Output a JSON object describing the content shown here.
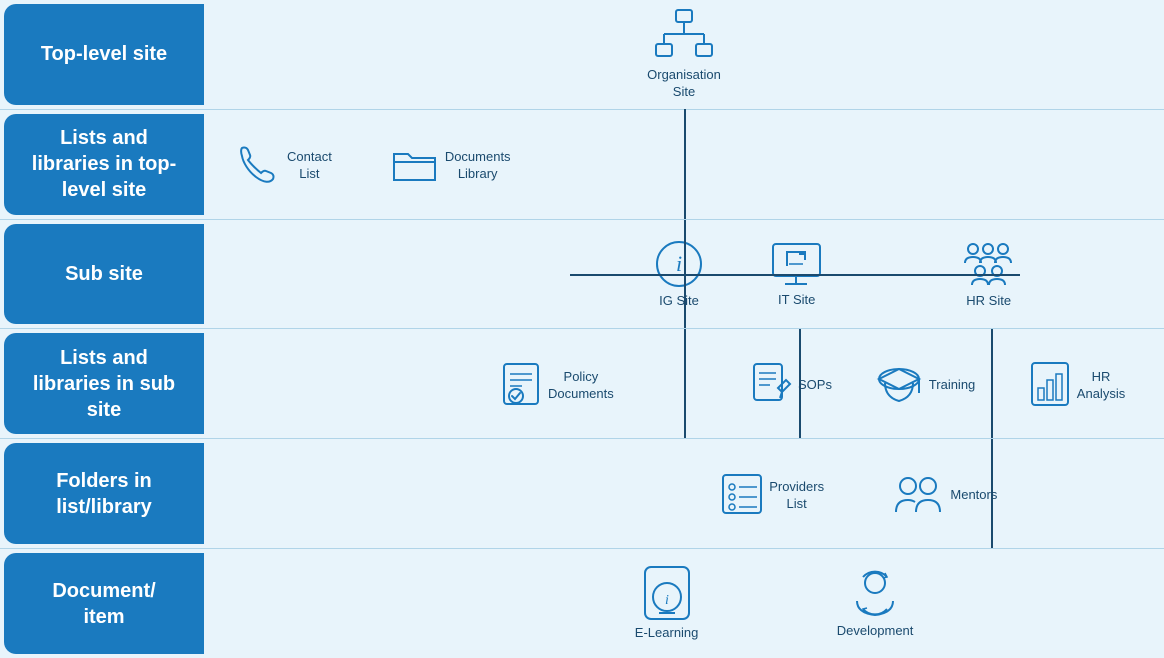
{
  "rows": [
    {
      "id": "top-level-site",
      "label": "Top-level site",
      "nodes": [
        {
          "id": "org-site",
          "label": "Organisation\nSite",
          "icon": "org"
        }
      ]
    },
    {
      "id": "lists-top",
      "label": "Lists and\nlibraries in top-\nlevel site",
      "nodes": [
        {
          "id": "contact-list",
          "label": "Contact\nList",
          "icon": "phone"
        },
        {
          "id": "documents-library",
          "label": "Documents\nLibrary",
          "icon": "folder"
        }
      ]
    },
    {
      "id": "sub-site",
      "label": "Sub site",
      "nodes": [
        {
          "id": "ig-site",
          "label": "IG Site",
          "icon": "info"
        },
        {
          "id": "it-site",
          "label": "IT Site",
          "icon": "monitor"
        },
        {
          "id": "hr-site",
          "label": "HR Site",
          "icon": "people"
        }
      ]
    },
    {
      "id": "lists-sub",
      "label": "Lists and\nlibraries in sub\nsite",
      "nodes": [
        {
          "id": "policy-docs",
          "label": "Policy\nDocuments",
          "icon": "doc-check"
        },
        {
          "id": "sops",
          "label": "SOPs",
          "icon": "doc-pen"
        },
        {
          "id": "training",
          "label": "Training",
          "icon": "graduation"
        },
        {
          "id": "hr-analysis",
          "label": "HR\nAnalysis",
          "icon": "chart"
        }
      ]
    },
    {
      "id": "folders",
      "label": "Folders in\nlist/library",
      "nodes": [
        {
          "id": "providers-list",
          "label": "Providers\nList",
          "icon": "list"
        },
        {
          "id": "mentors",
          "label": "Mentors",
          "icon": "users"
        }
      ]
    },
    {
      "id": "document-item",
      "label": "Document/\nitem",
      "nodes": [
        {
          "id": "e-learning",
          "label": "E-Learning",
          "icon": "tablet-info"
        },
        {
          "id": "development",
          "label": "Development",
          "icon": "user-cycle"
        }
      ]
    }
  ]
}
